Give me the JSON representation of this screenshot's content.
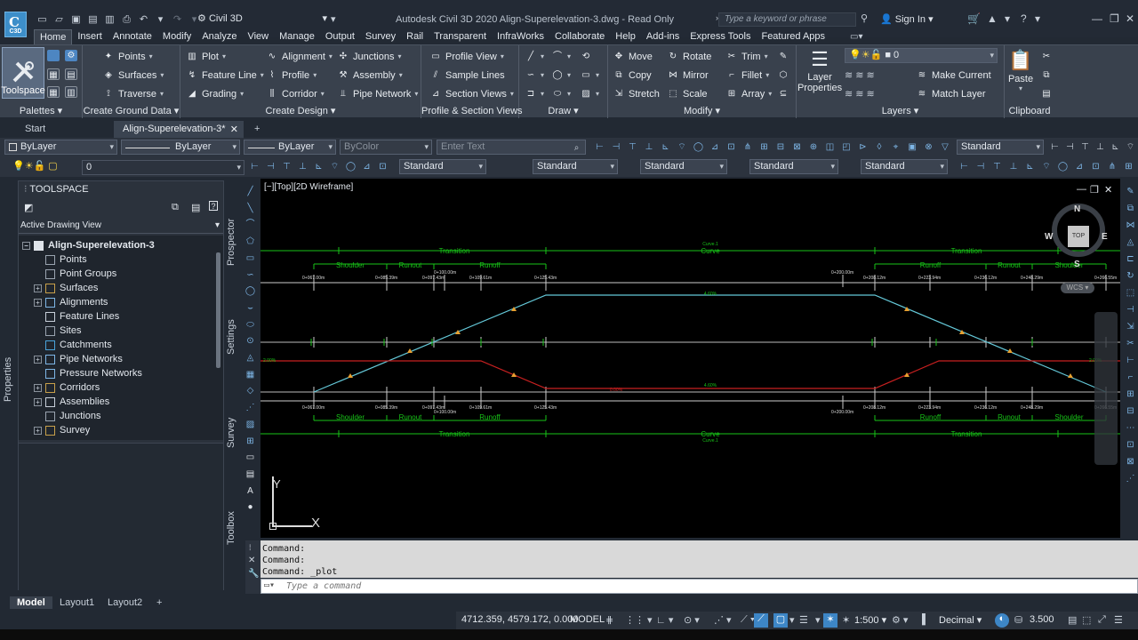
{
  "titlebar": {
    "logo_text": "C3D",
    "workspace": "Civil 3D",
    "title": "Autodesk Civil 3D 2020   Align-Superelevation-3.dwg - Read Only",
    "search_placeholder": "Type a keyword or phrase",
    "signin": "Sign In"
  },
  "menu": {
    "tabs": [
      "Home",
      "Insert",
      "Annotate",
      "Modify",
      "Analyze",
      "View",
      "Manage",
      "Output",
      "Survey",
      "Rail",
      "Transparent",
      "InfraWorks",
      "Collaborate",
      "Help",
      "Add-ins",
      "Express Tools",
      "Featured Apps"
    ]
  },
  "ribbon": {
    "toolspace": "Toolspace",
    "palettes": "Palettes",
    "points": "Points",
    "surfaces": "Surfaces",
    "traverse": "Traverse",
    "create_ground_data": "Create Ground Data",
    "plot": "Plot",
    "feature_line": "Feature Line",
    "grading": "Grading",
    "alignment": "Alignment",
    "profile": "Profile",
    "corridor": "Corridor",
    "junctions": "Junctions",
    "assembly": "Assembly",
    "pipe_network": "Pipe Network",
    "create_design": "Create Design",
    "profile_view": "Profile View",
    "sample_lines": "Sample Lines",
    "section_views": "Section Views",
    "profile_section_views": "Profile & Section Views",
    "draw": "Draw",
    "move": "Move",
    "copy": "Copy",
    "stretch": "Stretch",
    "rotate": "Rotate",
    "mirror": "Mirror",
    "scale": "Scale",
    "trim": "Trim",
    "fillet": "Fillet",
    "array": "Array",
    "modify": "Modify",
    "layer_properties": "Layer Properties",
    "layer_name": "0",
    "make_current": "Make Current",
    "match_layer": "Match Layer",
    "layers": "Layers",
    "paste": "Paste",
    "clipboard": "Clipboard"
  },
  "doctabs": {
    "start": "Start",
    "active": "Align-Superelevation-3*"
  },
  "props": {
    "color": "ByLayer",
    "linetype": "ByLayer",
    "lineweight": "ByLayer",
    "plotstyle": "ByColor",
    "text_placeholder": "Enter Text",
    "style1": "Standard",
    "layer": "0",
    "style2": "Standard",
    "style3": "Standard",
    "style4": "Standard",
    "style5": "Standard",
    "style6": "Standard"
  },
  "toolspace": {
    "header": "TOOLSPACE",
    "view": "Active Drawing View",
    "root": "Align-Superelevation-3",
    "items": [
      "Points",
      "Point Groups",
      "Surfaces",
      "Alignments",
      "Feature Lines",
      "Sites",
      "Catchments",
      "Pipe Networks",
      "Pressure Networks",
      "Corridors",
      "Assemblies",
      "Junctions",
      "Survey"
    ]
  },
  "vtabs": {
    "prospector": "Prospector",
    "settings": "Settings",
    "survey": "Survey",
    "toolbox": "Toolbox",
    "properties": "Properties"
  },
  "viewport": {
    "label": "[−][Top][2D Wireframe]",
    "compass_n": "N",
    "compass_s": "S",
    "compass_e": "E",
    "compass_w": "W",
    "top": "TOP",
    "wcs": "WCS",
    "ucs_x": "X",
    "ucs_y": "Y",
    "labels": {
      "transition": "Transition",
      "curve": "Curve",
      "curve1": "Curve.1",
      "shoulder": "Shoulder",
      "runout": "Runout",
      "runoff": "Runoff"
    },
    "stations_top": [
      "0+067.00m",
      "0+085.39m",
      "0+097.43m",
      "0+109.61m",
      "0+125.43m",
      "0+208.12m",
      "0+223.94m",
      "0+236.12m",
      "0+248.29m",
      "0+266.55m"
    ],
    "stations_bottom": [
      "0+067.00m",
      "0+085.39m",
      "0+097.43m",
      "0+109.61m",
      "0+125.43m",
      "0+208.12m",
      "0+223.94m",
      "0+236.12m",
      "0+248.29m",
      "0+266.55m"
    ],
    "station_100": "0+100.00m",
    "station_200": "0+200.00m",
    "pct_top": "4.60%",
    "pct_mid": "4.60%",
    "pct_small": "0.00%",
    "pct_left": "2.00%",
    "pct_right": "2.00%"
  },
  "command": {
    "history": [
      "Command:",
      "Command:",
      "Command:  _plot"
    ],
    "placeholder": "Type a command"
  },
  "layouts": [
    "Model",
    "Layout1",
    "Layout2"
  ],
  "status": {
    "coords": "4712.359, 4579.172, 0.000",
    "model": "MODEL",
    "scale": "1:500",
    "units": "Decimal",
    "zoom": "3.500"
  }
}
